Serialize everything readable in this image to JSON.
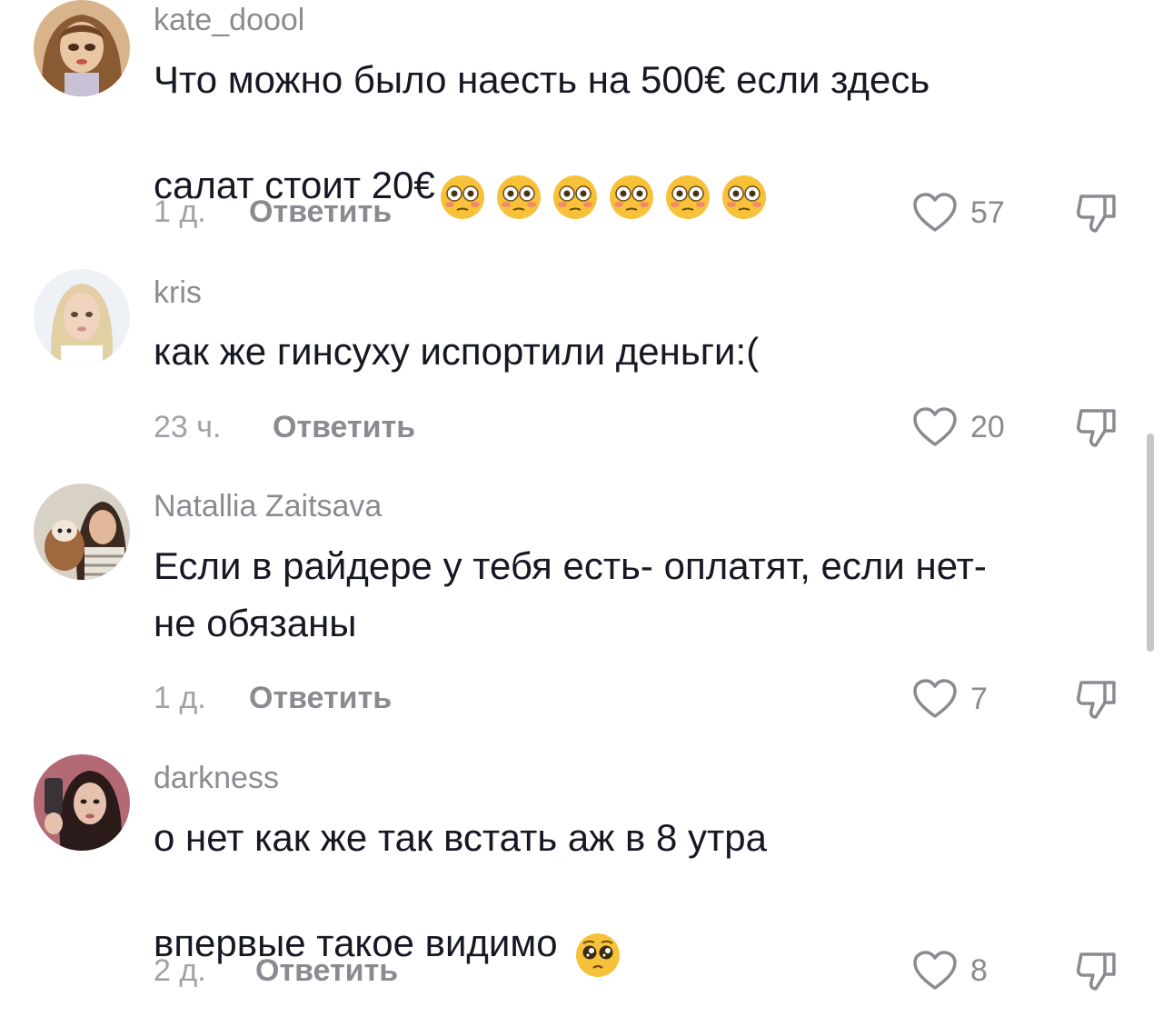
{
  "comments": [
    {
      "username": "kate_doool",
      "text": "Что можно было наесть на 500€ если здесь\nсалат стоит 20€",
      "emoji": [
        "flushed-face-icon",
        "flushed-face-icon",
        "flushed-face-icon",
        "flushed-face-icon",
        "flushed-face-icon",
        "flushed-face-icon"
      ],
      "time": "1 д.",
      "reply_label": "Ответить",
      "likes": "57"
    },
    {
      "username": "kris",
      "text": "как же гинсуху испортили деньги:(",
      "time": "23 ч.",
      "reply_label": "Ответить",
      "likes": "20"
    },
    {
      "username": "Natallia Zaitsava",
      "text": "Если в райдере у тебя есть- оплатят, если нет-\nне обязаны",
      "time": "1 д.",
      "reply_label": "Ответить",
      "likes": "7"
    },
    {
      "username": "darkness",
      "text": "о нет как же так встать аж в 8 утра\nвпервые такое видимо",
      "emoji": [
        "pleading-face-icon"
      ],
      "time": "2 д.",
      "reply_label": "Ответить",
      "likes": "8"
    }
  ],
  "colors": {
    "text": "#161823",
    "secondary": "#8a8b91",
    "time": "#a1a2a7",
    "emoji_yellow": "#f7c23a"
  }
}
